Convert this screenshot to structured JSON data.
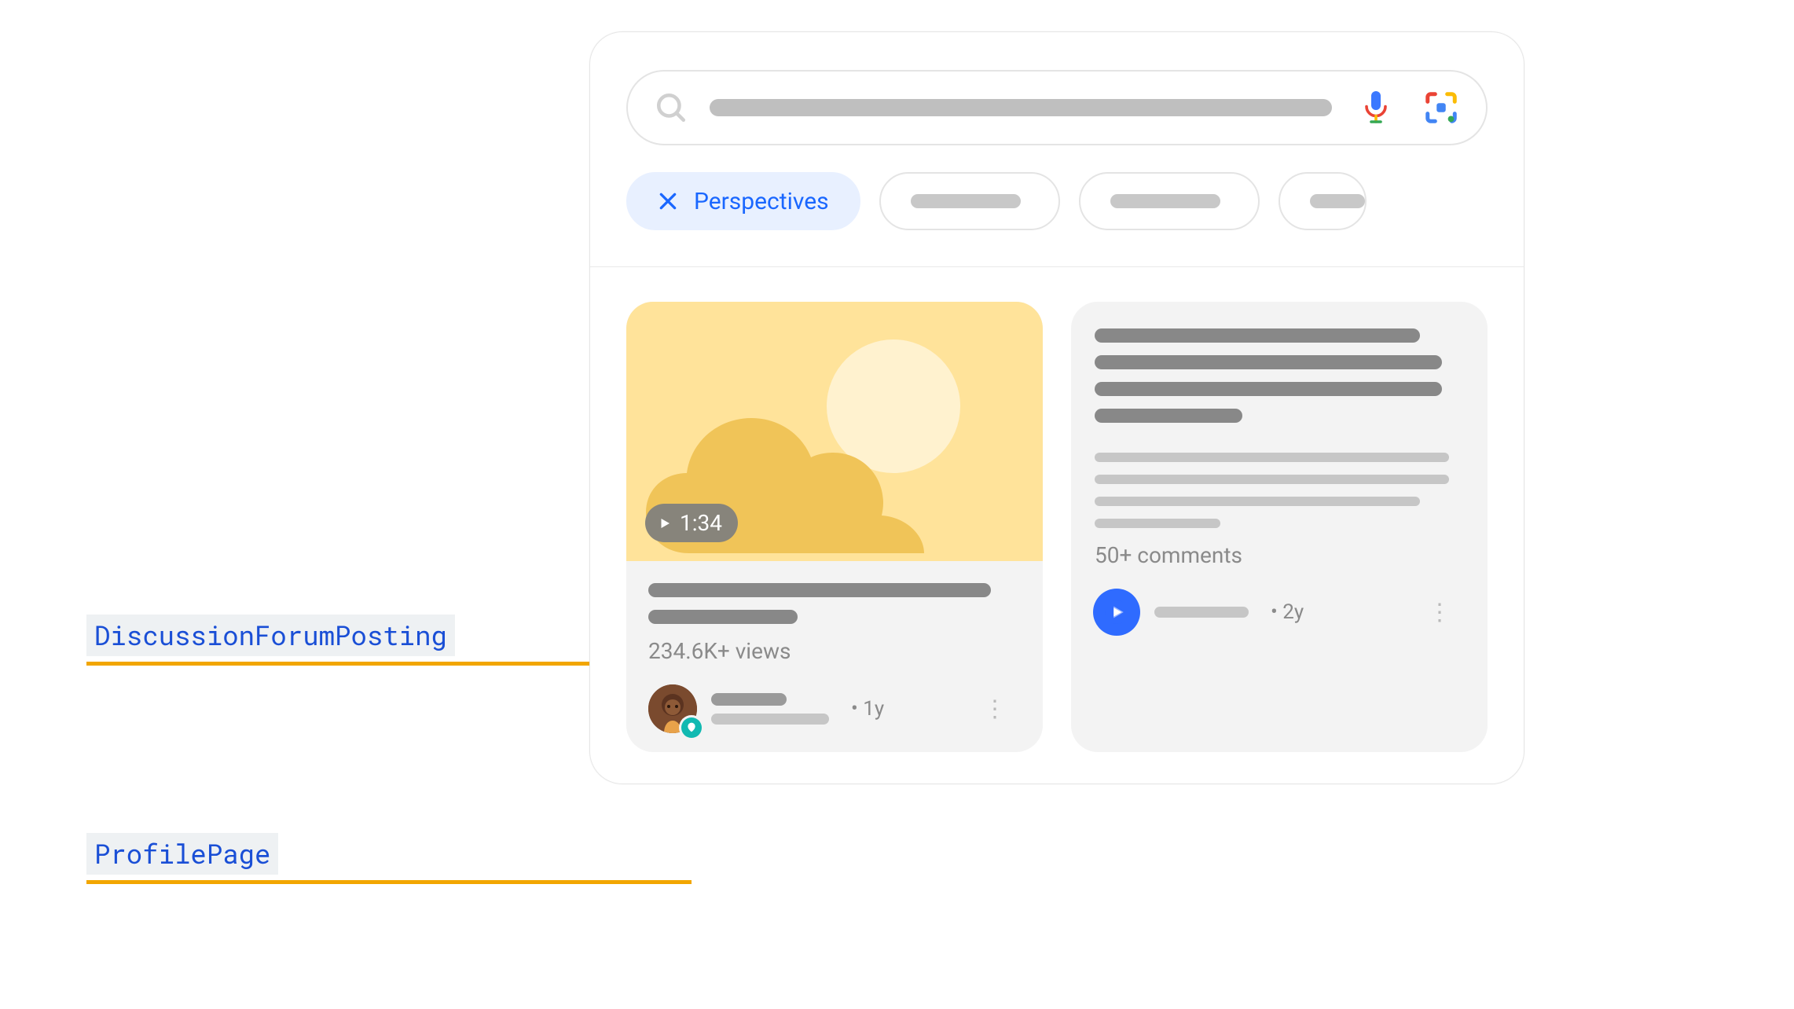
{
  "annotations": {
    "discussion": "DiscussionForumPosting",
    "profile": "ProfilePage"
  },
  "search": {
    "placeholder": ""
  },
  "chips": {
    "active": "Perspectives"
  },
  "card1": {
    "duration": "1:34",
    "meta": "234.6K+ views",
    "age": "1y",
    "ageSep": "• "
  },
  "card2": {
    "meta": "50+ comments",
    "age": "2y",
    "ageSep": "• "
  },
  "colors": {
    "accentBlue": "#1a67ff",
    "ruleOrange": "#f2a600"
  }
}
